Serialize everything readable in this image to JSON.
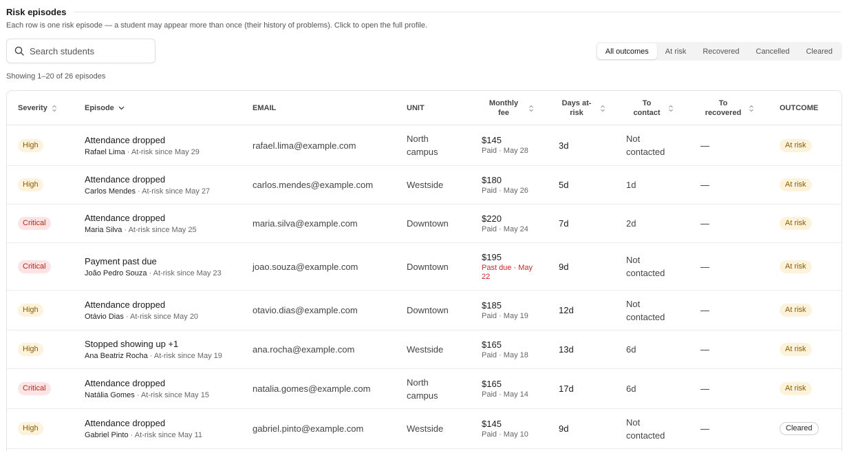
{
  "section": {
    "title": "Risk episodes",
    "description": "Each row is one risk episode — a student may appear more than once (their history of problems). Click to open the full profile."
  },
  "search": {
    "placeholder": "Search students",
    "value": ""
  },
  "filters": [
    "All outcomes",
    "At risk",
    "Recovered",
    "Cancelled",
    "Cleared"
  ],
  "active_filter": "All outcomes",
  "showing": "Showing 1–20 of 26 episodes",
  "columns": {
    "severity": "Severity",
    "episode": "Episode",
    "email": "EMAIL",
    "unit": "UNIT",
    "fee": "Monthly fee",
    "days": "Days at-risk",
    "to_contact": "To contact",
    "to_recovered": "To recovered",
    "outcome": "OUTCOME"
  },
  "rows": [
    {
      "severity": "High",
      "severity_class": "high",
      "title": "Attendance dropped",
      "name": "Rafael Lima",
      "since": " · At-risk since May 29",
      "email": "rafael.lima@example.com",
      "unit": "North campus",
      "fee": "$145",
      "fee_status": "Paid · May 28",
      "fee_due": false,
      "days": "3d",
      "to_contact": "Not contacted",
      "to_recovered": "—",
      "outcome": "At risk",
      "outcome_class": "atrisk"
    },
    {
      "severity": "High",
      "severity_class": "high",
      "title": "Attendance dropped",
      "name": "Carlos Mendes",
      "since": " · At-risk since May 27",
      "email": "carlos.mendes@example.com",
      "unit": "Westside",
      "fee": "$180",
      "fee_status": "Paid · May 26",
      "fee_due": false,
      "days": "5d",
      "to_contact": "1d",
      "to_recovered": "—",
      "outcome": "At risk",
      "outcome_class": "atrisk"
    },
    {
      "severity": "Critical",
      "severity_class": "critical",
      "title": "Attendance dropped",
      "name": "Maria Silva",
      "since": " · At-risk since May 25",
      "email": "maria.silva@example.com",
      "unit": "Downtown",
      "fee": "$220",
      "fee_status": "Paid · May 24",
      "fee_due": false,
      "days": "7d",
      "to_contact": "2d",
      "to_recovered": "—",
      "outcome": "At risk",
      "outcome_class": "atrisk"
    },
    {
      "severity": "Critical",
      "severity_class": "critical",
      "title": "Payment past due",
      "name": "João Pedro Souza",
      "since": " · At-risk since May 23",
      "email": "joao.souza@example.com",
      "unit": "Downtown",
      "fee": "$195",
      "fee_status": "Past due · May 22",
      "fee_due": true,
      "days": "9d",
      "to_contact": "Not contacted",
      "to_recovered": "—",
      "outcome": "At risk",
      "outcome_class": "atrisk"
    },
    {
      "severity": "High",
      "severity_class": "high",
      "title": "Attendance dropped",
      "name": "Otávio Dias",
      "since": " · At-risk since May 20",
      "email": "otavio.dias@example.com",
      "unit": "Downtown",
      "fee": "$185",
      "fee_status": "Paid · May 19",
      "fee_due": false,
      "days": "12d",
      "to_contact": "Not contacted",
      "to_recovered": "—",
      "outcome": "At risk",
      "outcome_class": "atrisk"
    },
    {
      "severity": "High",
      "severity_class": "high",
      "title": "Stopped showing up +1",
      "name": "Ana Beatriz Rocha",
      "since": " · At-risk since May 19",
      "email": "ana.rocha@example.com",
      "unit": "Westside",
      "fee": "$165",
      "fee_status": "Paid · May 18",
      "fee_due": false,
      "days": "13d",
      "to_contact": "6d",
      "to_recovered": "—",
      "outcome": "At risk",
      "outcome_class": "atrisk"
    },
    {
      "severity": "Critical",
      "severity_class": "critical",
      "title": "Attendance dropped",
      "name": "Natália Gomes",
      "since": " · At-risk since May 15",
      "email": "natalia.gomes@example.com",
      "unit": "North campus",
      "fee": "$165",
      "fee_status": "Paid · May 14",
      "fee_due": false,
      "days": "17d",
      "to_contact": "6d",
      "to_recovered": "—",
      "outcome": "At risk",
      "outcome_class": "atrisk"
    },
    {
      "severity": "High",
      "severity_class": "high",
      "title": "Attendance dropped",
      "name": "Gabriel Pinto",
      "since": " · At-risk since May 11",
      "email": "gabriel.pinto@example.com",
      "unit": "Westside",
      "fee": "$145",
      "fee_status": "Paid · May 10",
      "fee_due": false,
      "days": "9d",
      "to_contact": "Not contacted",
      "to_recovered": "—",
      "outcome": "Cleared",
      "outcome_class": "cleared"
    }
  ]
}
